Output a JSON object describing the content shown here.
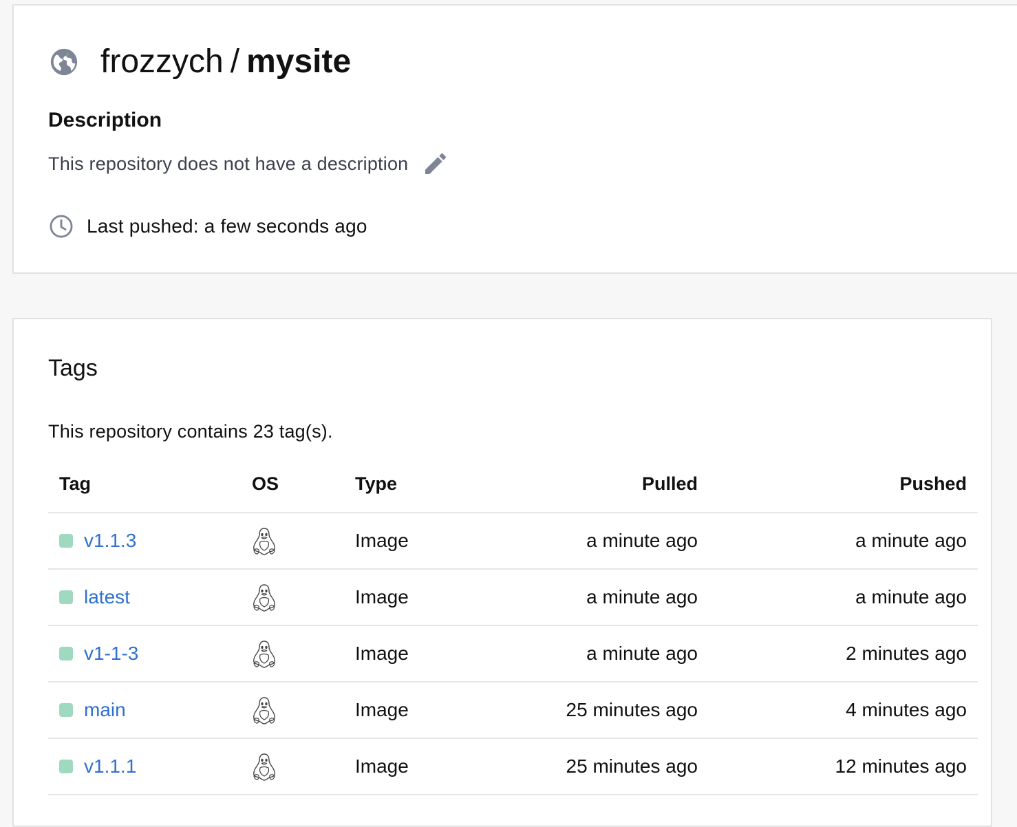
{
  "repo": {
    "owner": "frozzych",
    "separator": "/",
    "name": "mysite",
    "visibility_icon": "globe-icon"
  },
  "description": {
    "heading": "Description",
    "text": "This repository does not have a description",
    "edit_icon": "pencil-icon"
  },
  "last_pushed": {
    "label": "Last pushed: a few seconds ago",
    "icon": "clock-icon"
  },
  "tags": {
    "heading": "Tags",
    "count_text": "This repository contains 23 tag(s).",
    "columns": {
      "tag": "Tag",
      "os": "OS",
      "type": "Type",
      "pulled": "Pulled",
      "pushed": "Pushed"
    },
    "rows": [
      {
        "tag": "v1.1.3",
        "os_icon": "linux-icon",
        "type": "Image",
        "pulled": "a minute ago",
        "pushed": "a minute ago"
      },
      {
        "tag": "latest",
        "os_icon": "linux-icon",
        "type": "Image",
        "pulled": "a minute ago",
        "pushed": "a minute ago"
      },
      {
        "tag": "v1-1-3",
        "os_icon": "linux-icon",
        "type": "Image",
        "pulled": "a minute ago",
        "pushed": "2 minutes ago"
      },
      {
        "tag": "main",
        "os_icon": "linux-icon",
        "type": "Image",
        "pulled": "25 minutes ago",
        "pushed": "4 minutes ago"
      },
      {
        "tag": "v1.1.1",
        "os_icon": "linux-icon",
        "type": "Image",
        "pulled": "25 minutes ago",
        "pushed": "12 minutes ago"
      }
    ]
  },
  "colors": {
    "link": "#2f6fd0",
    "tag_status_dot": "#9fd9c0",
    "icon_gray": "#7e8595"
  }
}
